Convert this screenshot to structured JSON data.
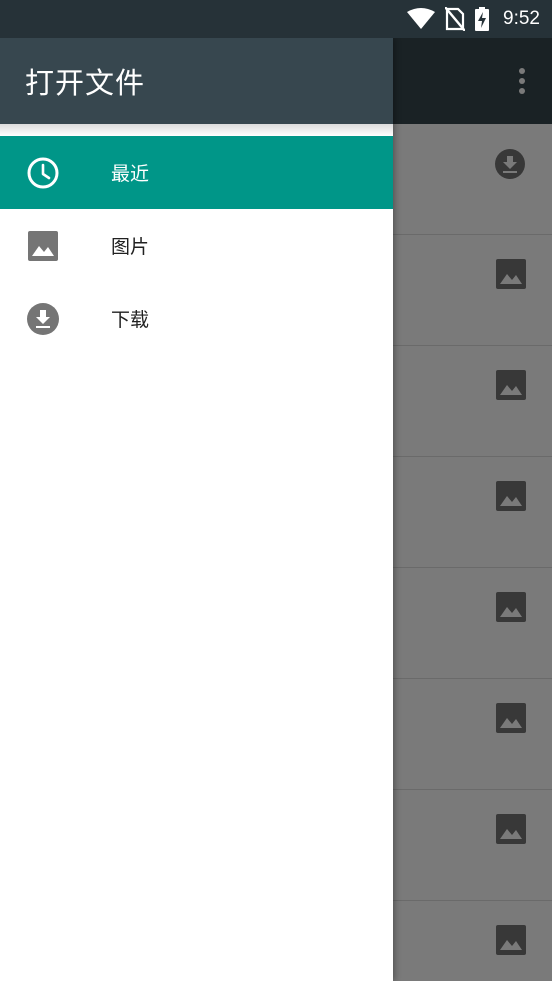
{
  "status_bar": {
    "time": "9:52",
    "icons": [
      "wifi-icon",
      "no-sim-icon",
      "battery-charging-icon"
    ]
  },
  "drawer": {
    "title": "打开文件",
    "items": [
      {
        "label": "最近",
        "icon": "clock-icon",
        "active": true
      },
      {
        "label": "图片",
        "icon": "image-icon",
        "active": false
      },
      {
        "label": "下载",
        "icon": "download-icon",
        "active": false
      }
    ]
  },
  "background": {
    "menu_icon": "more-vert-icon",
    "rows": [
      {
        "icon": "download-icon"
      },
      {
        "icon": "image-icon"
      },
      {
        "icon": "image-icon"
      },
      {
        "icon": "image-icon"
      },
      {
        "icon": "image-icon"
      },
      {
        "icon": "image-icon"
      },
      {
        "icon": "image-icon"
      },
      {
        "icon": "image-icon"
      }
    ]
  },
  "colors": {
    "status_bar": "#263238",
    "toolbar": "#37474f",
    "accent": "#009688",
    "icon_gray": "#757575"
  }
}
